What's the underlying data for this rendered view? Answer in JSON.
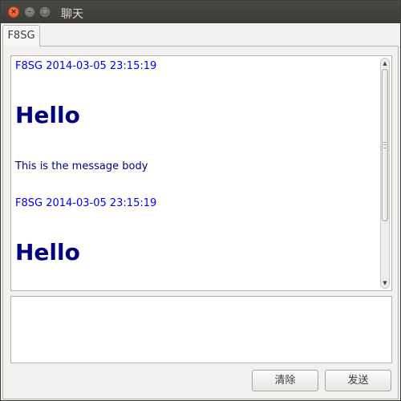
{
  "window": {
    "title": "聊天",
    "close_glyph": "×",
    "minimize_glyph": "–",
    "maximize_glyph": "□"
  },
  "tabs": [
    {
      "label": "F8SG",
      "active": true
    }
  ],
  "chat": {
    "messages": [
      {
        "header": "F8SG 2014-03-05 23:15:19",
        "title": "Hello",
        "body": "This is the message body"
      },
      {
        "header": "F8SG 2014-03-05 23:15:19",
        "title": "Hello"
      }
    ]
  },
  "input": {
    "value": "",
    "placeholder": ""
  },
  "buttons": {
    "clear_label": "清除",
    "send_label": "发送"
  },
  "colors": {
    "header_link": "#0000ee",
    "message_text": "#000080",
    "titlebar": "#3c3b37",
    "close_button": "#e0501d"
  },
  "icons": {
    "scroll_up": "▲",
    "scroll_down": "▼"
  }
}
